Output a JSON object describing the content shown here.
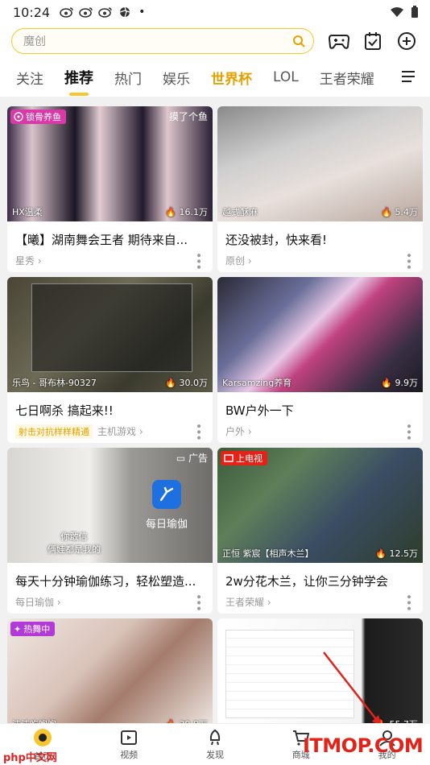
{
  "status": {
    "time": "10:24",
    "dot": "•"
  },
  "search": {
    "placeholder": "魔创"
  },
  "tabs": [
    "关注",
    "推荐",
    "热门",
    "娱乐",
    "世界杯",
    "LOL",
    "王者荣耀"
  ],
  "cards": [
    {
      "badge": "锁骨养鱼",
      "top_right": "摸了个鱼",
      "streamer": "HX温柔",
      "views": "16.1万",
      "title": "【曦】湖南舞会王者  期待来自...",
      "category": "星秀"
    },
    {
      "streamer": "越式酥麻",
      "views": "5.4万",
      "title": "还没被封，快来看!",
      "category": "原创"
    },
    {
      "streamer": "乐鸟 - 哥布林-90327",
      "views": "30.0万",
      "title": "七日啊杀 搞起来!!",
      "tag": "射击对抗样样精通",
      "category": "主机游戏"
    },
    {
      "streamer": "Karsamzing养育",
      "views": "9.9万",
      "title": "BW户外一下",
      "category": "户外"
    },
    {
      "top_right": "广告",
      "ad_label": "每日瑜伽",
      "caption": "你敢信\n俩娃都是我的",
      "title": "每天十分钟瑜伽练习，轻松塑造...",
      "category": "每日瑜伽"
    },
    {
      "badge": "上电视",
      "streamer": "正恒 紫宸【相声木兰】",
      "views": "12.5万",
      "title": "2w分花木兰，让你三分钟学会",
      "category": "王者荣耀"
    },
    {
      "badge": "热舞中",
      "streamer": "洁洁吃饱饱",
      "views": "39.8万"
    },
    {
      "views": "55.7万"
    }
  ],
  "nav": [
    "首页",
    "视频",
    "发现",
    "商城",
    "我的"
  ],
  "watermark": {
    "left": "php中文网",
    "right": "ITMOP.COM"
  },
  "colors": {
    "accent": "#f7c62f",
    "gold": "#e5a100",
    "pink": "#d83aa7",
    "red": "#e2231a"
  }
}
